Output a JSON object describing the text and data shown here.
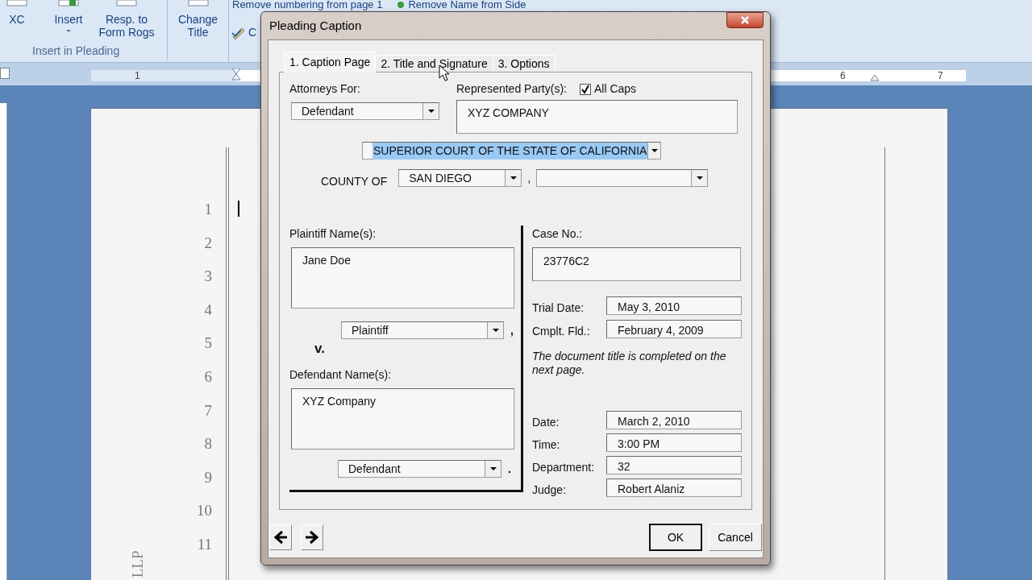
{
  "ribbon": {
    "buttons": [
      {
        "label": "XC",
        "dropdown": false
      },
      {
        "label": "Insert",
        "dropdown": true
      },
      {
        "label": "Resp. to Form Rogs",
        "dropdown": false
      },
      {
        "label": "Change Title",
        "dropdown": false
      }
    ],
    "group_label": "Insert in Pleading",
    "small_buttons": [
      {
        "label": "Remove numbering from page 1"
      },
      {
        "label": "Remove Name from Side"
      },
      {
        "label": "C"
      }
    ]
  },
  "ruler": {
    "marks": [
      "1",
      "6",
      "7"
    ]
  },
  "document": {
    "line_numbers": [
      "1",
      "2",
      "3",
      "4",
      "5",
      "6",
      "7",
      "8",
      "9",
      "10",
      "11"
    ],
    "side_text": "LLP"
  },
  "dialog": {
    "title": "Pleading Caption",
    "tabs": [
      {
        "label": "1. Caption Page",
        "selected": true
      },
      {
        "label": "2. Title and Signature",
        "selected": false
      },
      {
        "label": "3. Options",
        "selected": false
      }
    ],
    "attorneys_for": {
      "label": "Attorneys For:",
      "value": "Defendant"
    },
    "represented_party": {
      "label": "Represented Party(s):",
      "value": "XYZ COMPANY"
    },
    "all_caps": {
      "label": "All Caps",
      "checked": true
    },
    "court": {
      "value": "SUPERIOR COURT OF THE STATE OF CALIFORNIA",
      "highlighted": true
    },
    "county": {
      "label": "COUNTY OF",
      "value": "SAN DIEGO",
      "separator": ","
    },
    "plaintiff": {
      "label": "Plaintiff Name(s):",
      "names": "Jane Doe",
      "role": "Plaintiff",
      "suffix": ","
    },
    "versus": "v.",
    "defendant": {
      "label": "Defendant Name(s):",
      "names": "XYZ Company",
      "role": "Defendant",
      "suffix": "."
    },
    "case_no": {
      "label": "Case No.:",
      "value": "23776C2"
    },
    "dates": [
      {
        "label": "Trial Date:",
        "value": "May 3, 2010"
      },
      {
        "label": "Cmplt. Fld.:",
        "value": "February 4, 2009"
      }
    ],
    "note": "The document title is completed on the next page.",
    "hearing": [
      {
        "label": "Date:",
        "value": "March 2, 2010"
      },
      {
        "label": "Time:",
        "value": "3:00 PM"
      },
      {
        "label": "Department:",
        "value": "32"
      },
      {
        "label": "Judge:",
        "value": "Robert Alaniz"
      }
    ],
    "buttons": [
      {
        "label": "OK",
        "default": true
      },
      {
        "label": "Cancel",
        "default": false
      }
    ]
  }
}
